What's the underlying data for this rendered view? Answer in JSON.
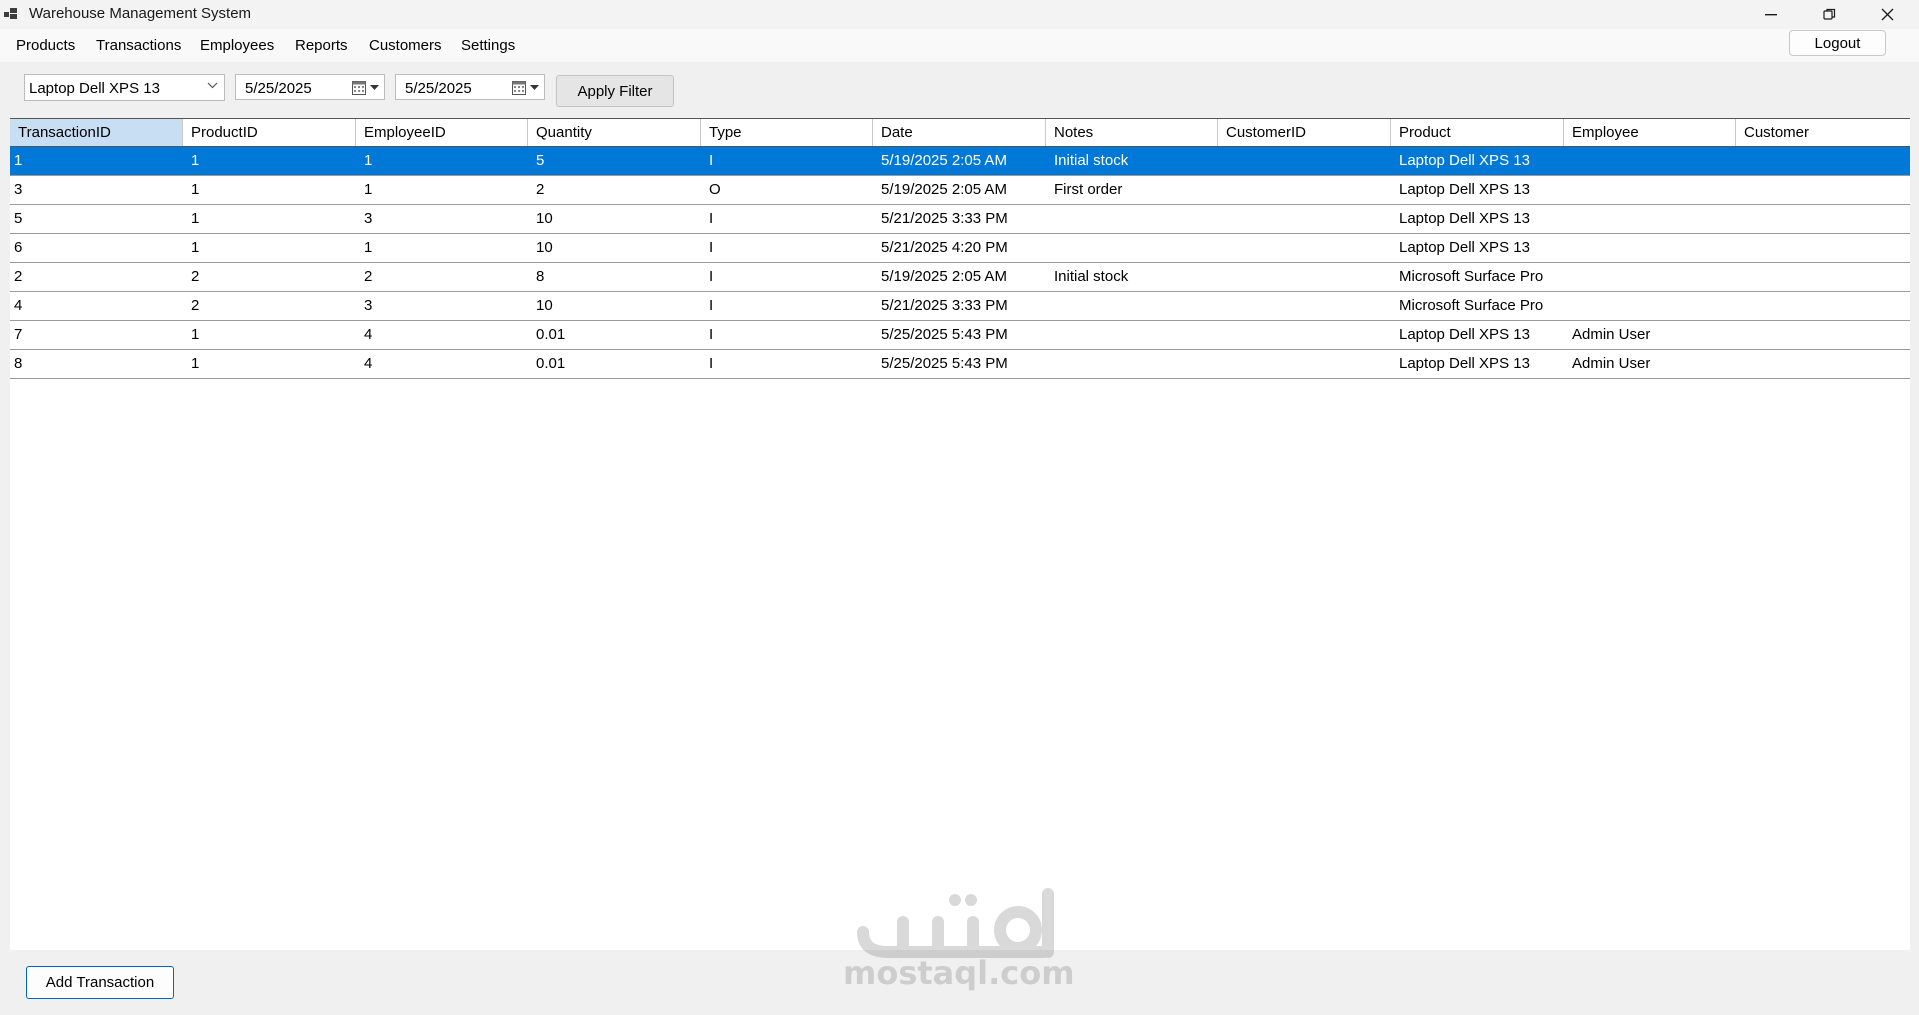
{
  "window": {
    "title": "Warehouse Management System",
    "controls": {
      "minimize": "minimize-icon",
      "restore": "restore-icon",
      "close": "close-icon"
    }
  },
  "menu": {
    "items": [
      "Products",
      "Transactions",
      "Employees",
      "Reports",
      "Customers",
      "Settings"
    ],
    "logout_label": "Logout"
  },
  "filter": {
    "product_selected": "Laptop Dell XPS 13",
    "start_date": "5/25/2025",
    "end_date": "5/25/2025",
    "apply_label": "Apply Filter"
  },
  "grid": {
    "columns": [
      "TransactionID",
      "ProductID",
      "EmployeeID",
      "Quantity",
      "Type",
      "Date",
      "Notes",
      "CustomerID",
      "Product",
      "Employee",
      "Customer"
    ],
    "rows": [
      [
        "1",
        "1",
        "1",
        "5",
        "I",
        "5/19/2025 2:05 AM",
        "Initial stock",
        "",
        "Laptop Dell XPS 13",
        "",
        ""
      ],
      [
        "3",
        "1",
        "1",
        "2",
        "O",
        "5/19/2025 2:05 AM",
        "First order",
        "",
        "Laptop Dell XPS 13",
        "",
        ""
      ],
      [
        "5",
        "1",
        "3",
        "10",
        "I",
        "5/21/2025 3:33 PM",
        "",
        "",
        "Laptop Dell XPS 13",
        "",
        ""
      ],
      [
        "6",
        "1",
        "1",
        "10",
        "I",
        "5/21/2025 4:20 PM",
        "",
        "",
        "Laptop Dell XPS 13",
        "",
        ""
      ],
      [
        "2",
        "2",
        "2",
        "8",
        "I",
        "5/19/2025 2:05 AM",
        "Initial stock",
        "",
        "Microsoft Surface Pro",
        "",
        ""
      ],
      [
        "4",
        "2",
        "3",
        "10",
        "I",
        "5/21/2025 3:33 PM",
        "",
        "",
        "Microsoft Surface Pro",
        "",
        ""
      ],
      [
        "7",
        "1",
        "4",
        "0.01",
        "I",
        "5/25/2025 5:43 PM",
        "",
        "",
        "Laptop Dell XPS 13",
        "Admin User",
        ""
      ],
      [
        "8",
        "1",
        "4",
        "0.01",
        "I",
        "5/25/2025 5:43 PM",
        "",
        "",
        "Laptop Dell XPS 13",
        "Admin User",
        ""
      ]
    ],
    "selected_row": 0
  },
  "footer": {
    "add_label": "Add Transaction"
  },
  "watermark": {
    "arabic": "مستقل",
    "text": "mostaql.com"
  },
  "colors": {
    "selection": "#0078d7",
    "header_active": "#c8def3",
    "accent_border": "#0067c0"
  }
}
